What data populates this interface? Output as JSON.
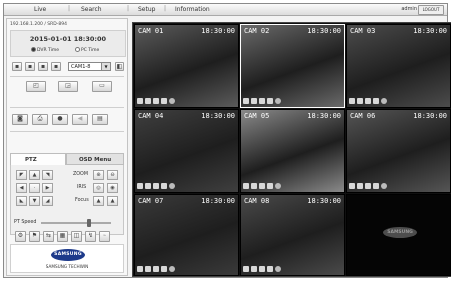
{
  "nav": {
    "items": [
      "Live",
      "Search",
      "Setup",
      "Information"
    ],
    "user": "admin",
    "logout": "LOGOUT"
  },
  "left": {
    "device": "192.168.1.200 / SRD-894",
    "datetime": "2015-01-01 18:30:00",
    "dvr_time": "DVR Time",
    "pc_time": "PC Time",
    "camera_select": "CAM1-8"
  },
  "ptz": {
    "tab_ptz": "PTZ",
    "tab_osd": "OSD Menu",
    "zoom": "ZOOM",
    "iris": "IRIS",
    "focus": "Focus",
    "speed": "PT Speed",
    "speed_level": 0.7
  },
  "logo": {
    "brand": "SAMSUNG",
    "sub": "SAMSUNG TECHWIN"
  },
  "cameras": [
    {
      "name": "CAM 01",
      "time": "18:30:00",
      "color": "#5b5b5b"
    },
    {
      "name": "CAM 02",
      "time": "18:30:00",
      "color": "#6a6a6a"
    },
    {
      "name": "CAM 03",
      "time": "18:30:00",
      "color": "#4c4c4c"
    },
    {
      "name": "CAM 04",
      "time": "18:30:00",
      "color": "#3f3f3f"
    },
    {
      "name": "CAM 05",
      "time": "18:30:00",
      "color": "#8a8a8a"
    },
    {
      "name": "CAM 06",
      "time": "18:30:00",
      "color": "#555555"
    },
    {
      "name": "CAM 07",
      "time": "18:30:00",
      "color": "#3a3a3a"
    },
    {
      "name": "CAM 08",
      "time": "18:30:00",
      "color": "#4a4a4a"
    },
    {
      "name": "",
      "time": "",
      "color": "#0a0a0a"
    }
  ],
  "empty_cell_logo": "SAMSUNG"
}
